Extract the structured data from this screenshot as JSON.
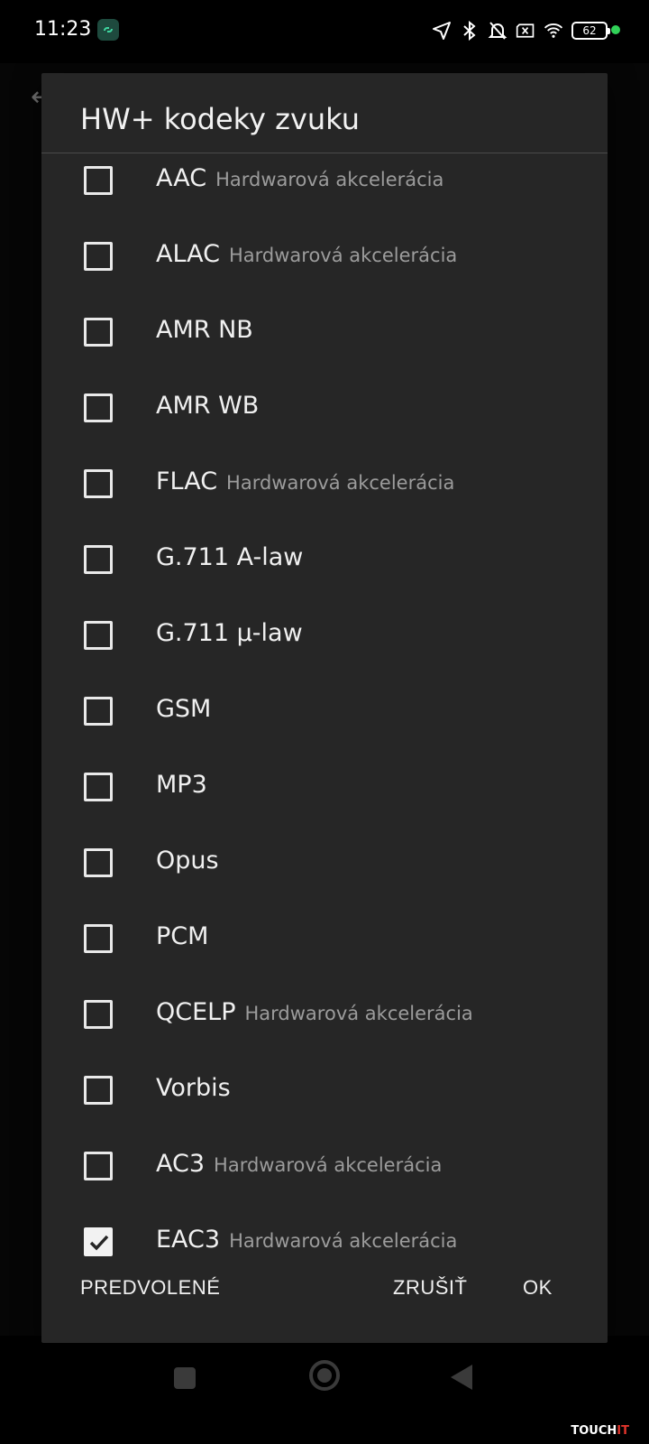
{
  "status_bar": {
    "time": "11:23",
    "battery": "62",
    "icons": [
      "location-icon",
      "bluetooth-icon",
      "bell-off-icon",
      "sim-off-icon",
      "wifi-icon",
      "battery-icon"
    ]
  },
  "dialog": {
    "title": "HW+ kodeky zvuku",
    "items": [
      {
        "label": "AAC",
        "sub": "Hardwarová akcelerácia",
        "checked": false
      },
      {
        "label": "ALAC",
        "sub": "Hardwarová akcelerácia",
        "checked": false
      },
      {
        "label": "AMR NB",
        "sub": "",
        "checked": false
      },
      {
        "label": "AMR WB",
        "sub": "",
        "checked": false
      },
      {
        "label": "FLAC",
        "sub": "Hardwarová akcelerácia",
        "checked": false
      },
      {
        "label": "G.711 A-law",
        "sub": "",
        "checked": false
      },
      {
        "label": "G.711 μ-law",
        "sub": "",
        "checked": false
      },
      {
        "label": "GSM",
        "sub": "",
        "checked": false
      },
      {
        "label": "MP3",
        "sub": "",
        "checked": false
      },
      {
        "label": "Opus",
        "sub": "",
        "checked": false
      },
      {
        "label": "PCM",
        "sub": "",
        "checked": false
      },
      {
        "label": "QCELP",
        "sub": "Hardwarová akcelerácia",
        "checked": false
      },
      {
        "label": "Vorbis",
        "sub": "",
        "checked": false
      },
      {
        "label": "AC3",
        "sub": "Hardwarová akcelerácia",
        "checked": false
      },
      {
        "label": "EAC3",
        "sub": "Hardwarová akcelerácia",
        "checked": true
      }
    ],
    "buttons": {
      "default": "PREDVOLENÉ",
      "cancel": "ZRUŠIŤ",
      "ok": "OK"
    }
  },
  "watermark": {
    "main": "TOUCH",
    "accent": "IT"
  }
}
